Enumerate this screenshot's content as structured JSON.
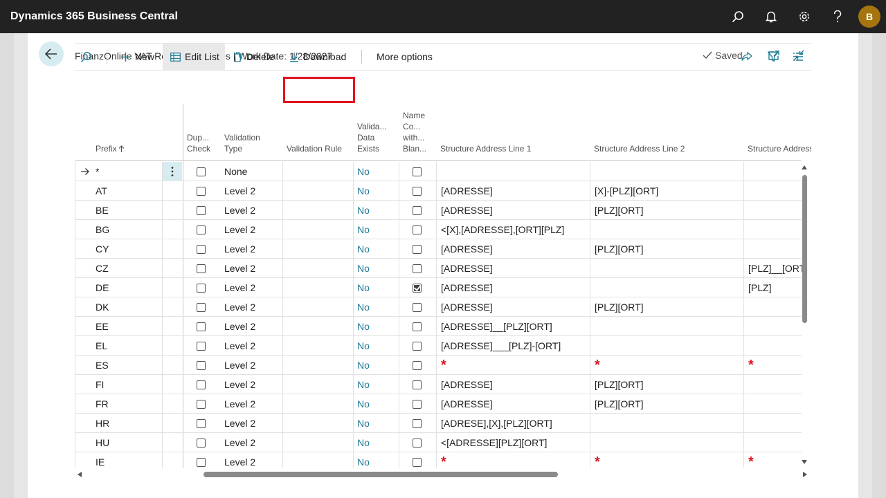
{
  "app": {
    "title": "Dynamics 365 Business Central",
    "user_initial": "B"
  },
  "colors": {
    "accent": "#1e7a96",
    "topbar": "#222222",
    "highlight": "#e0141e",
    "avatar": "#a6740f"
  },
  "page": {
    "title": "FinanzOnline VAT Reg. No. Prefixes | Work Date: 1/28/2027",
    "saved_label": "Saved"
  },
  "actions": {
    "new": "New",
    "edit_list": "Edit List",
    "delete": "Delete",
    "download": "Download",
    "more_options": "More options"
  },
  "columns": {
    "prefix": "Prefix",
    "dup_check": [
      "Dup...",
      "Check"
    ],
    "validation_type": [
      "Validation",
      "Type"
    ],
    "validation_rule": "Validation Rule",
    "valida_data_exists": [
      "Valida...",
      "Data",
      "Exists"
    ],
    "name_co_blank": [
      "Name",
      "Co...",
      "with...",
      "Blan..."
    ],
    "addr1": "Structure Address Line 1",
    "addr2": "Structure Address Line 2",
    "addr3": "Structure Address"
  },
  "rows": [
    {
      "prefix": "*",
      "dup": false,
      "vtype": "None",
      "exists": "No",
      "blank": false,
      "a1": "",
      "a2": "",
      "a3": ""
    },
    {
      "prefix": "AT",
      "dup": false,
      "vtype": "Level 2",
      "exists": "No",
      "blank": false,
      "a1": "[ADRESSE]",
      "a2": "[X]-[PLZ][ORT]",
      "a3": ""
    },
    {
      "prefix": "BE",
      "dup": false,
      "vtype": "Level 2",
      "exists": "No",
      "blank": false,
      "a1": "[ADRESSE]",
      "a2": "[PLZ][ORT]",
      "a3": ""
    },
    {
      "prefix": "BG",
      "dup": false,
      "vtype": "Level 2",
      "exists": "No",
      "blank": false,
      "a1": "<[X],[ADRESSE],[ORT][PLZ]",
      "a2": "",
      "a3": ""
    },
    {
      "prefix": "CY",
      "dup": false,
      "vtype": "Level 2",
      "exists": "No",
      "blank": false,
      "a1": "[ADRESSE]",
      "a2": "[PLZ][ORT]",
      "a3": ""
    },
    {
      "prefix": "CZ",
      "dup": false,
      "vtype": "Level 2",
      "exists": "No",
      "blank": false,
      "a1": "[ADRESSE]",
      "a2": "",
      "a3": "[PLZ]__[ORT]"
    },
    {
      "prefix": "DE",
      "dup": false,
      "vtype": "Level 2",
      "exists": "No",
      "blank": true,
      "a1": "[ADRESSE]",
      "a2": "",
      "a3": "[PLZ]"
    },
    {
      "prefix": "DK",
      "dup": false,
      "vtype": "Level 2",
      "exists": "No",
      "blank": false,
      "a1": "[ADRESSE]",
      "a2": "[PLZ][ORT]",
      "a3": ""
    },
    {
      "prefix": "EE",
      "dup": false,
      "vtype": "Level 2",
      "exists": "No",
      "blank": false,
      "a1": "[ADRESSE]__[PLZ][ORT]",
      "a2": "",
      "a3": ""
    },
    {
      "prefix": "EL",
      "dup": false,
      "vtype": "Level 2",
      "exists": "No",
      "blank": false,
      "a1": "[ADRESSE]___[PLZ]-[ORT]",
      "a2": "",
      "a3": ""
    },
    {
      "prefix": "ES",
      "dup": false,
      "vtype": "Level 2",
      "exists": "No",
      "blank": false,
      "a1": "*",
      "a2": "*",
      "a3": "*"
    },
    {
      "prefix": "FI",
      "dup": false,
      "vtype": "Level 2",
      "exists": "No",
      "blank": false,
      "a1": "[ADRESSE]",
      "a2": "[PLZ][ORT]",
      "a3": ""
    },
    {
      "prefix": "FR",
      "dup": false,
      "vtype": "Level 2",
      "exists": "No",
      "blank": false,
      "a1": "[ADRESSE]",
      "a2": "[PLZ][ORT]",
      "a3": ""
    },
    {
      "prefix": "HR",
      "dup": false,
      "vtype": "Level 2",
      "exists": "No",
      "blank": false,
      "a1": "[ADRESE],[X],[PLZ][ORT]",
      "a2": "",
      "a3": ""
    },
    {
      "prefix": "HU",
      "dup": false,
      "vtype": "Level 2",
      "exists": "No",
      "blank": false,
      "a1": "<[ADRESSE][PLZ][ORT]",
      "a2": "",
      "a3": ""
    },
    {
      "prefix": "IE",
      "dup": false,
      "vtype": "Level 2",
      "exists": "No",
      "blank": false,
      "a1": "*",
      "a2": "*",
      "a3": "*"
    }
  ]
}
